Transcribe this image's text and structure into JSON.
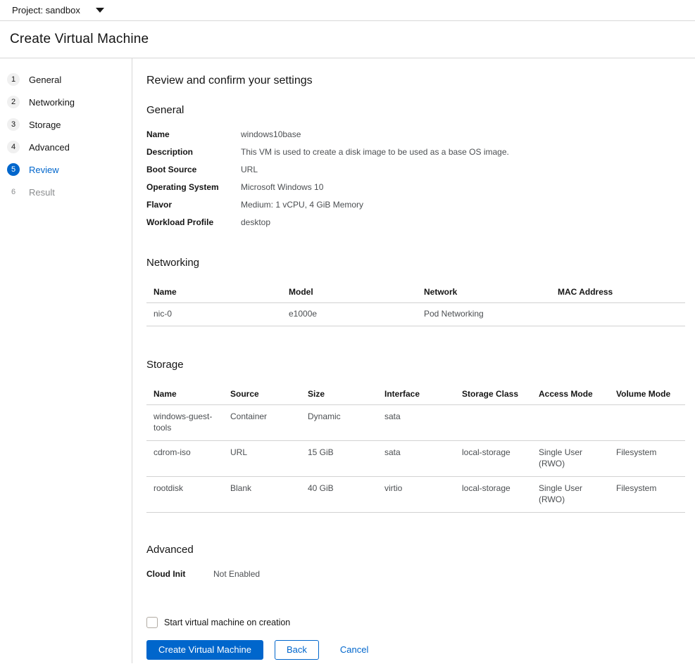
{
  "topbar": {
    "project_label": "Project: sandbox"
  },
  "header": {
    "title": "Create Virtual Machine"
  },
  "wizard": {
    "steps": [
      {
        "num": "1",
        "label": "General",
        "state": "normal"
      },
      {
        "num": "2",
        "label": "Networking",
        "state": "normal"
      },
      {
        "num": "3",
        "label": "Storage",
        "state": "normal"
      },
      {
        "num": "4",
        "label": "Advanced",
        "state": "normal"
      },
      {
        "num": "5",
        "label": "Review",
        "state": "current"
      },
      {
        "num": "6",
        "label": "Result",
        "state": "disabled"
      }
    ]
  },
  "review": {
    "title": "Review and confirm your settings",
    "general": {
      "heading": "General",
      "fields": [
        {
          "label": "Name",
          "value": "windows10base"
        },
        {
          "label": "Description",
          "value": "This VM is used to create a disk image to be used as a base OS image."
        },
        {
          "label": "Boot Source",
          "value": "URL"
        },
        {
          "label": "Operating System",
          "value": "Microsoft Windows 10"
        },
        {
          "label": "Flavor",
          "value": "Medium: 1 vCPU, 4 GiB Memory"
        },
        {
          "label": "Workload Profile",
          "value": "desktop"
        }
      ]
    },
    "networking": {
      "heading": "Networking",
      "columns": [
        "Name",
        "Model",
        "Network",
        "MAC Address"
      ],
      "rows": [
        [
          "nic-0",
          "e1000e",
          "Pod Networking",
          ""
        ]
      ]
    },
    "storage": {
      "heading": "Storage",
      "columns": [
        "Name",
        "Source",
        "Size",
        "Interface",
        "Storage Class",
        "Access Mode",
        "Volume Mode"
      ],
      "rows": [
        [
          "windows-guest-tools",
          "Container",
          "Dynamic",
          "sata",
          "",
          "",
          ""
        ],
        [
          "cdrom-iso",
          "URL",
          "15 GiB",
          "sata",
          "local-storage",
          "Single User (RWO)",
          "Filesystem"
        ],
        [
          "rootdisk",
          "Blank",
          "40 GiB",
          "virtio",
          "local-storage",
          "Single User (RWO)",
          "Filesystem"
        ]
      ]
    },
    "advanced": {
      "heading": "Advanced",
      "fields": [
        {
          "label": "Cloud Init",
          "value": "Not Enabled"
        }
      ]
    }
  },
  "footer": {
    "start_checkbox_label": "Start virtual machine on creation",
    "start_checkbox_checked": false,
    "create_button": "Create Virtual Machine",
    "back_button": "Back",
    "cancel_link": "Cancel"
  },
  "colors": {
    "primary_blue": "#0066cc",
    "text_dark": "#151515",
    "text_secondary": "#4c4f52",
    "border_gray": "#d2d2d2",
    "step_circle_bg": "#f0f0f0",
    "disabled_text": "#8b8d8f"
  }
}
